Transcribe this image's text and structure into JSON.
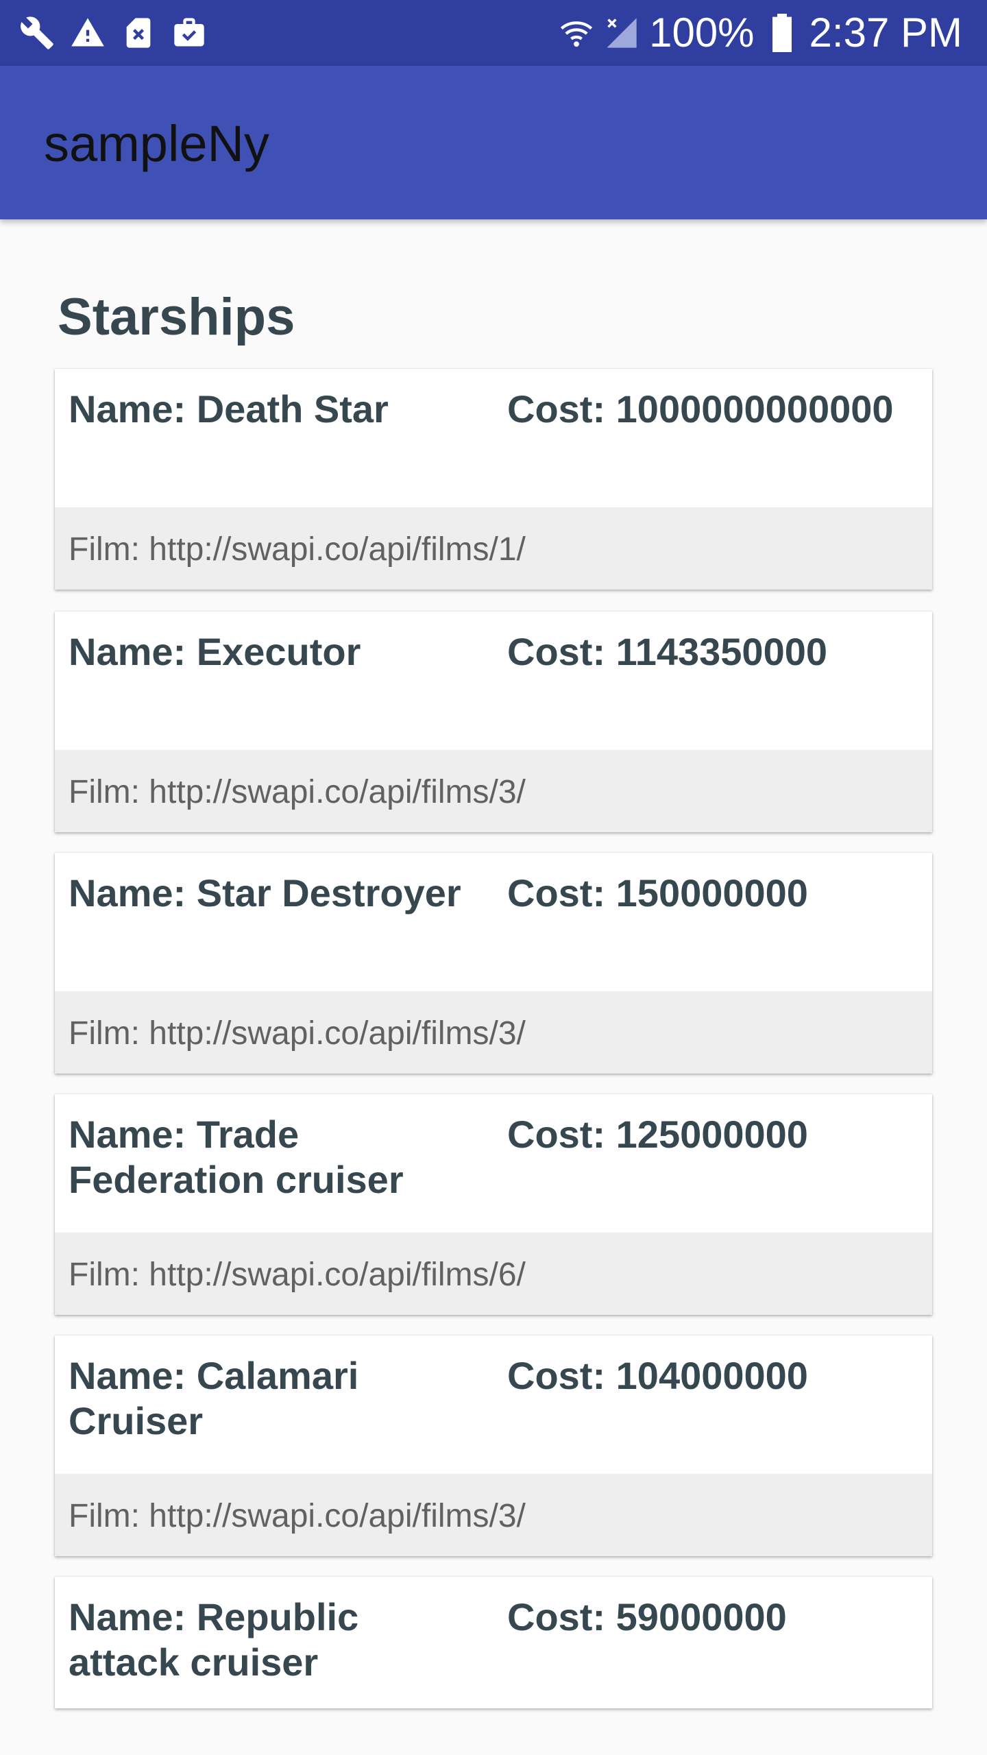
{
  "status_bar": {
    "icons": [
      "wrench-icon",
      "warning-icon",
      "sim-error-icon",
      "briefcase-check-icon"
    ],
    "battery_text": "100%",
    "time": "2:37 PM"
  },
  "app_bar": {
    "title": "sampleNy"
  },
  "section": {
    "title": "Starships"
  },
  "starships": [
    {
      "name": "Name: Death Star",
      "cost": "Cost: 1000000000000",
      "film": "Film: http://swapi.co/api/films/1/"
    },
    {
      "name": "Name: Executor",
      "cost": "Cost: 1143350000",
      "film": "Film: http://swapi.co/api/films/3/"
    },
    {
      "name": "Name: Star Destroyer",
      "cost": "Cost: 150000000",
      "film": "Film: http://swapi.co/api/films/3/"
    },
    {
      "name": "Name: Trade Federation cruiser",
      "cost": "Cost: 125000000",
      "film": "Film: http://swapi.co/api/films/6/"
    },
    {
      "name": "Name: Calamari Cruiser",
      "cost": "Cost: 104000000",
      "film": "Film: http://swapi.co/api/films/3/"
    },
    {
      "name": "Name: Republic attack cruiser",
      "cost": "Cost: 59000000",
      "film": ""
    }
  ],
  "colors": {
    "status_bar": "#303f9f",
    "app_bar": "#3f51b5",
    "background": "#fafafa",
    "card_text": "#37474f",
    "film_band": "#eeeeee"
  }
}
